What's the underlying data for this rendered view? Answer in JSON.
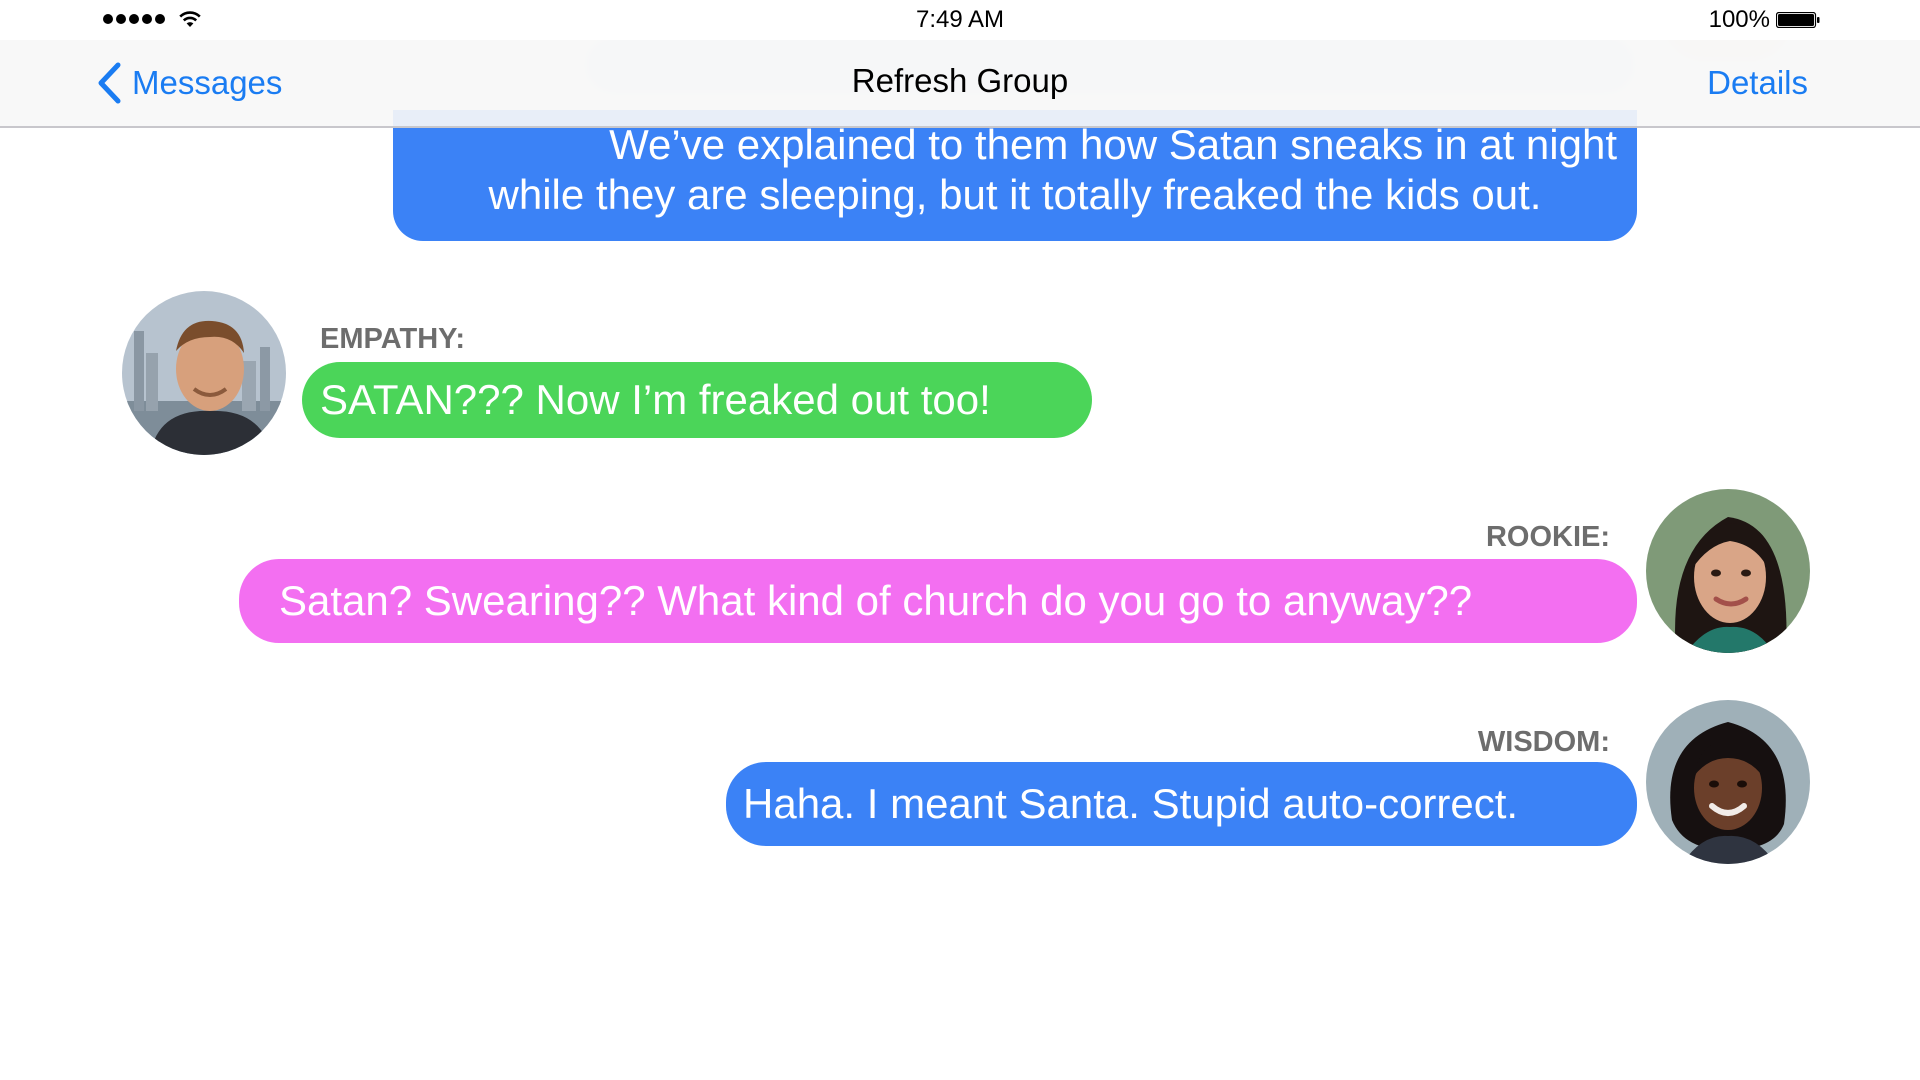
{
  "status_bar": {
    "time": "7:49 AM",
    "battery_percent": "100%",
    "signal_bars": 5,
    "icons": [
      "signal-dots-icon",
      "wifi-icon",
      "battery-icon"
    ]
  },
  "nav": {
    "back_label": "Messages",
    "title": "Refresh Group",
    "details_label": "Details",
    "icons": [
      "chevron-left-icon"
    ]
  },
  "colors": {
    "accent": "#1a7cf2",
    "bubble_blue": "#3b82f6",
    "bubble_green": "#4bd559",
    "bubble_pink": "#f36ff1",
    "sender_label": "#6d6d6d"
  },
  "messages": [
    {
      "sender": "",
      "lines": [
        "We’ve explained to them how Satan sneaks in at night",
        "while they are sleeping, but it totally freaked the kids out."
      ]
    },
    {
      "sender": "EMPATHY:",
      "text": "SATAN??? Now I’m freaked out too!"
    },
    {
      "sender": "ROOKIE:",
      "text": "Satan? Swearing?? What kind of church do you go to anyway??"
    },
    {
      "sender": "WISDOM:",
      "text": "Haha. I meant Santa. Stupid auto-correct."
    }
  ]
}
